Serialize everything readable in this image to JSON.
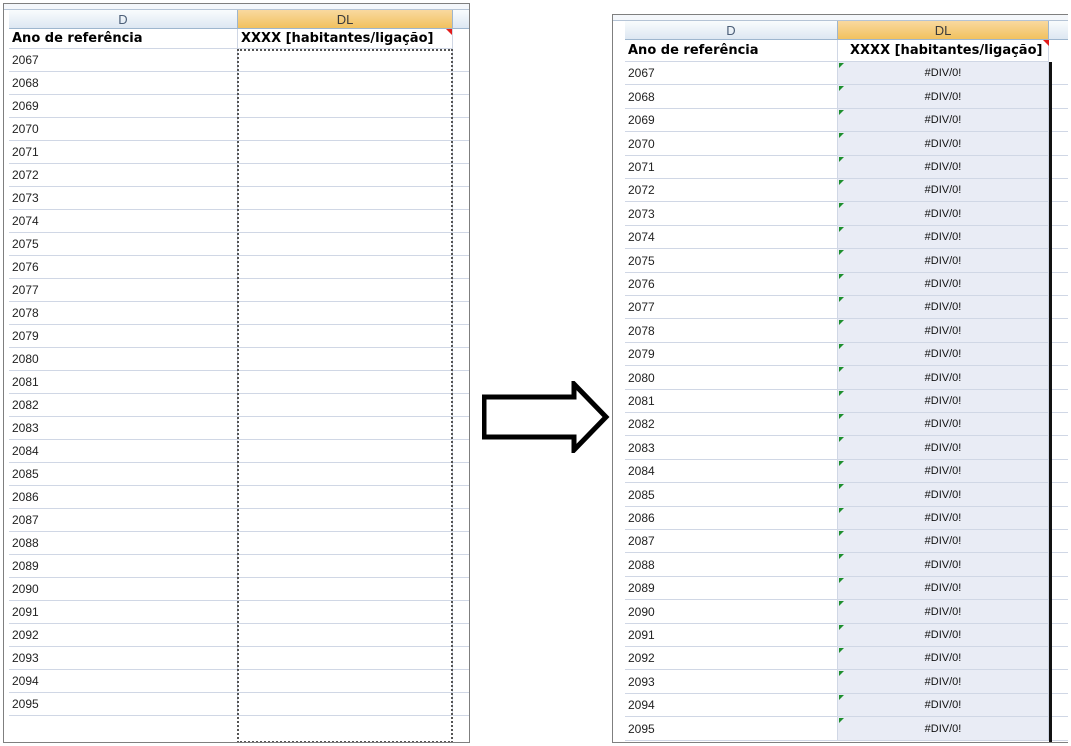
{
  "left_panel": {
    "col_d_header": "D",
    "col_dl_header": "DL",
    "header_d": "Ano de referência",
    "header_dl": "XXXX [habitantes/ligação]",
    "years": [
      "2067",
      "2068",
      "2069",
      "2070",
      "2071",
      "2072",
      "2073",
      "2074",
      "2075",
      "2076",
      "2077",
      "2078",
      "2079",
      "2080",
      "2081",
      "2082",
      "2083",
      "2084",
      "2085",
      "2086",
      "2087",
      "2088",
      "2089",
      "2090",
      "2091",
      "2092",
      "2093",
      "2094",
      "2095"
    ]
  },
  "right_panel": {
    "col_d_header": "D",
    "col_dl_header": "DL",
    "header_d": "Ano de referência",
    "header_dl": "XXXX [habitantes/ligação]",
    "years": [
      "2067",
      "2068",
      "2069",
      "2070",
      "2071",
      "2072",
      "2073",
      "2074",
      "2075",
      "2076",
      "2077",
      "2078",
      "2079",
      "2080",
      "2081",
      "2082",
      "2083",
      "2084",
      "2085",
      "2086",
      "2087",
      "2088",
      "2089",
      "2090",
      "2091",
      "2092",
      "2093",
      "2094",
      "2095"
    ],
    "value": "#DIV/0!"
  },
  "colors": {
    "selected_header": "#f1c15f",
    "gridline": "#d0d7e5",
    "error_fill": "#e9ecf5",
    "error_marker": "#1e8f2e",
    "comment_marker": "#e21b1b"
  },
  "arrow_icon": "right-arrow-icon"
}
